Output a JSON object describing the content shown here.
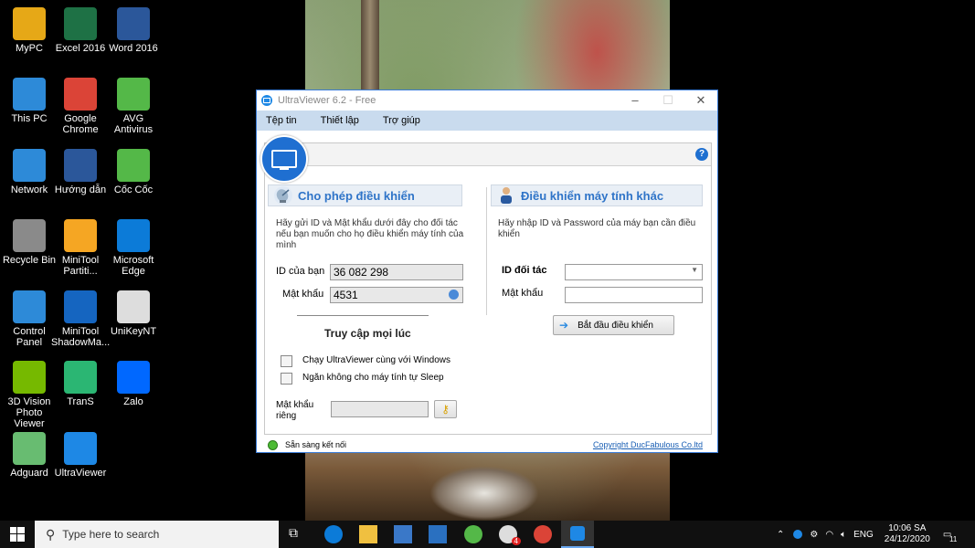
{
  "desktop": {
    "icons": [
      {
        "label": "MyPC",
        "icon": "mypc-icon",
        "color": "#e6a817"
      },
      {
        "label": "Excel 2016",
        "icon": "excel-icon",
        "color": "#1e7145"
      },
      {
        "label": "Word 2016",
        "icon": "word-icon",
        "color": "#2b579a"
      },
      {
        "label": "This PC",
        "icon": "this-pc-icon",
        "color": "#2d8ad8"
      },
      {
        "label": "Google Chrome",
        "icon": "chrome-icon",
        "color": "#db4437"
      },
      {
        "label": "AVG Antivirus",
        "icon": "avg-icon",
        "color": "#54b848"
      },
      {
        "label": "Network",
        "icon": "network-icon",
        "color": "#2d8ad8"
      },
      {
        "label": "Hướng dẫn",
        "icon": "document-icon",
        "color": "#2b579a"
      },
      {
        "label": "Cốc Cốc",
        "icon": "coccoc-icon",
        "color": "#54b848"
      },
      {
        "label": "Recycle Bin",
        "icon": "recycle-bin-icon",
        "color": "#8a8a8a"
      },
      {
        "label": "MiniTool Partiti...",
        "icon": "minitool-partition-icon",
        "color": "#f5a623"
      },
      {
        "label": "Microsoft Edge",
        "icon": "edge-icon",
        "color": "#0c7bd8"
      },
      {
        "label": "Control Panel",
        "icon": "control-panel-icon",
        "color": "#2d8ad8"
      },
      {
        "label": "MiniTool ShadowMa...",
        "icon": "minitool-shadowmaker-icon",
        "color": "#1565c0"
      },
      {
        "label": "UniKeyNT",
        "icon": "unikey-icon",
        "color": "#ddd"
      },
      {
        "label": "3D Vision Photo Viewer",
        "icon": "3d-vision-icon",
        "color": "#76b900"
      },
      {
        "label": "TranS",
        "icon": "trans-icon",
        "color": "#2bb673"
      },
      {
        "label": "Zalo",
        "icon": "zalo-icon",
        "color": "#0068ff"
      },
      {
        "label": "Adguard",
        "icon": "adguard-icon",
        "color": "#68bc71"
      },
      {
        "label": "UltraViewer",
        "icon": "ultraviewer-icon",
        "color": "#1e88e5"
      }
    ]
  },
  "window": {
    "title": "UltraViewer 6.2 - Free",
    "menu": [
      "Tệp tin",
      "Thiết lập",
      "Trợ giúp"
    ],
    "help": "?",
    "left": {
      "heading": "Cho phép điều khiển",
      "description": "Hãy gửi ID và Mật khẩu dưới đây cho đối tác nếu bạn muốn cho họ điều khiển máy tính của mình",
      "id_label": "ID của bạn",
      "id_value": "36 082 298",
      "password_label": "Mật khẩu",
      "password_value": "4531",
      "access_heading": "Truy cập mọi lúc",
      "check_startup": "Chạy UltraViewer cùng với Windows",
      "check_sleep": "Ngăn không cho máy tính tự Sleep",
      "private_password_label": "Mật khẩu riêng",
      "private_password_value": ""
    },
    "right": {
      "heading": "Điều khiển máy tính khác",
      "description": "Hãy nhập ID và Password của máy bạn cần điều khiển",
      "partner_id_label": "ID đối tác",
      "partner_id_value": "",
      "password_label": "Mật khẩu",
      "password_value": "",
      "start_button": "Bắt đầu điều khiển"
    },
    "status": {
      "text": "Sẵn sàng kết nối",
      "copyright": "Copyright DucFabulous Co.ltd"
    }
  },
  "taskbar": {
    "search_placeholder": "Type here to search",
    "mail_badge": "4",
    "language": "ENG",
    "time": "10:06 SA",
    "date": "24/12/2020",
    "notifications": "11"
  }
}
